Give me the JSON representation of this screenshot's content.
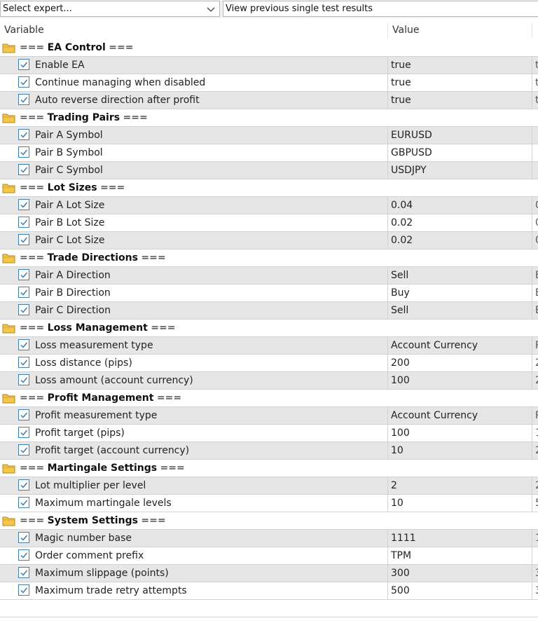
{
  "toolbar": {
    "expert_select": "Select expert...",
    "view_button": "View previous single test results"
  },
  "columns": {
    "variable": "Variable",
    "value": "Value"
  },
  "rows": [
    {
      "kind": "group",
      "label": "EA Control"
    },
    {
      "kind": "param",
      "name": "Enable EA",
      "value": "true",
      "clip": "t"
    },
    {
      "kind": "param",
      "name": "Continue managing when disabled",
      "value": "true",
      "clip": "t"
    },
    {
      "kind": "param",
      "name": "Auto reverse direction after profit",
      "value": "true",
      "clip": "t"
    },
    {
      "kind": "group",
      "label": "Trading Pairs"
    },
    {
      "kind": "param",
      "name": "Pair A Symbol",
      "value": "EURUSD",
      "clip": ""
    },
    {
      "kind": "param",
      "name": "Pair B Symbol",
      "value": "GBPUSD",
      "clip": ""
    },
    {
      "kind": "param",
      "name": "Pair C Symbol",
      "value": "USDJPY",
      "clip": ""
    },
    {
      "kind": "group",
      "label": "Lot Sizes"
    },
    {
      "kind": "param",
      "name": "Pair A Lot Size",
      "value": "0.04",
      "clip": "0"
    },
    {
      "kind": "param",
      "name": "Pair B Lot Size",
      "value": "0.02",
      "clip": "0"
    },
    {
      "kind": "param",
      "name": "Pair C Lot Size",
      "value": "0.02",
      "clip": "0"
    },
    {
      "kind": "group",
      "label": "Trade Directions"
    },
    {
      "kind": "param",
      "name": "Pair A Direction",
      "value": "Sell",
      "clip": "B"
    },
    {
      "kind": "param",
      "name": "Pair B Direction",
      "value": "Buy",
      "clip": "B"
    },
    {
      "kind": "param",
      "name": "Pair C Direction",
      "value": "Sell",
      "clip": "B"
    },
    {
      "kind": "group",
      "label": "Loss Management"
    },
    {
      "kind": "param",
      "name": "Loss measurement type",
      "value": "Account Currency",
      "clip": "P"
    },
    {
      "kind": "param",
      "name": "Loss distance (pips)",
      "value": "200",
      "clip": "2"
    },
    {
      "kind": "param",
      "name": "Loss amount (account currency)",
      "value": "100",
      "clip": "2"
    },
    {
      "kind": "group",
      "label": "Profit Management"
    },
    {
      "kind": "param",
      "name": "Profit measurement type",
      "value": "Account Currency",
      "clip": "P"
    },
    {
      "kind": "param",
      "name": "Profit target (pips)",
      "value": "100",
      "clip": "1"
    },
    {
      "kind": "param",
      "name": "Profit target (account currency)",
      "value": "10",
      "clip": "2"
    },
    {
      "kind": "group",
      "label": "Martingale Settings"
    },
    {
      "kind": "param",
      "name": "Lot multiplier per level",
      "value": "2",
      "clip": "2"
    },
    {
      "kind": "param",
      "name": "Maximum martingale levels",
      "value": "10",
      "clip": "5"
    },
    {
      "kind": "group",
      "label": "System Settings"
    },
    {
      "kind": "param",
      "name": "Magic number base",
      "value": "1111",
      "clip": "1"
    },
    {
      "kind": "param",
      "name": "Order comment prefix",
      "value": "TPM",
      "clip": ""
    },
    {
      "kind": "param",
      "name": "Maximum slippage (points)",
      "value": "300",
      "clip": "3"
    },
    {
      "kind": "param",
      "name": "Maximum trade retry attempts",
      "value": "500",
      "clip": "3"
    }
  ],
  "icons": {
    "group": "folder-icon",
    "param": "checkbox-checked-icon",
    "dropdown": "chevron-down-icon"
  },
  "colors": {
    "folder": "#f2c54b",
    "checkbox_border": "#3c7fb1",
    "row_shaded": "#e6e6e6"
  }
}
